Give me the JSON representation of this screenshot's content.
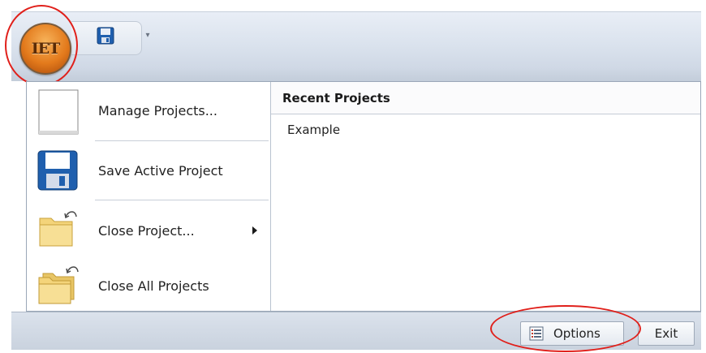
{
  "app": {
    "button_label": "IET",
    "accent_color": "#e37a1c",
    "highlight_color": "#e0201b"
  },
  "quick_access": {
    "icons": [
      "save-icon",
      "dropdown-icon"
    ]
  },
  "menu": {
    "items": [
      {
        "label": "Manage Projects...",
        "icon": "blank-page-icon"
      },
      {
        "label": "Save Active Project",
        "icon": "save-icon"
      },
      {
        "label": "Close Project...",
        "icon": "folder-icon",
        "has_submenu": true
      },
      {
        "label": "Close All Projects",
        "icon": "folders-icon"
      }
    ]
  },
  "recent": {
    "title": "Recent Projects",
    "items": [
      "Example"
    ]
  },
  "footer": {
    "options_label": "Options",
    "exit_label": "Exit"
  }
}
